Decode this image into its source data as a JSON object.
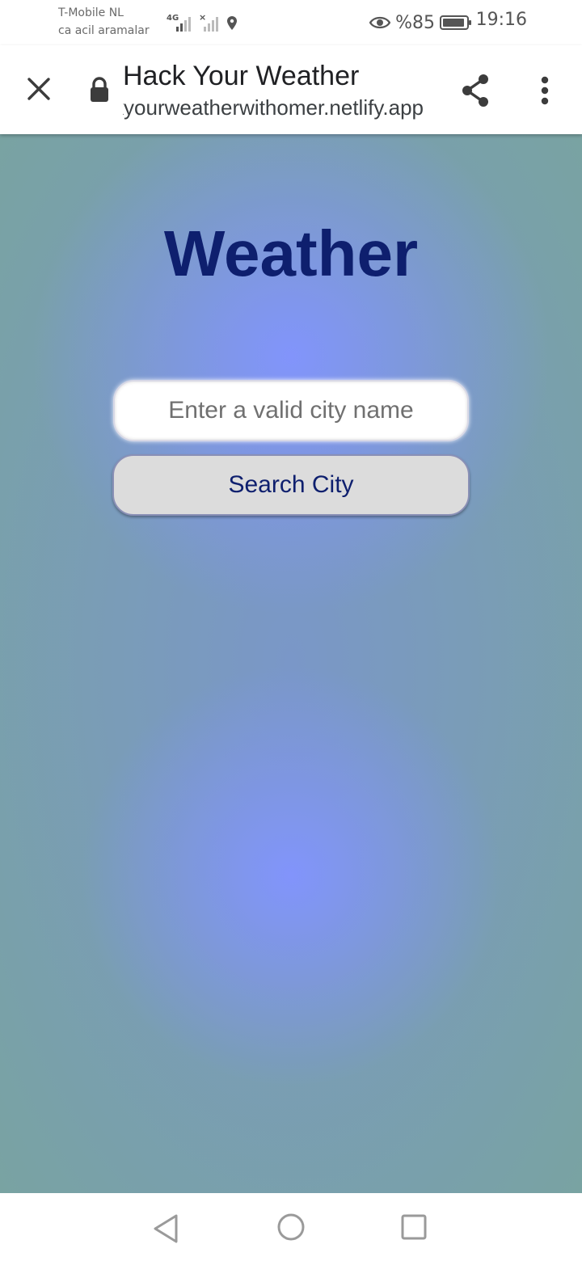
{
  "status_bar": {
    "carrier_line1": "T-Mobile  NL",
    "carrier_line2": "ca acil aramalar",
    "network_type": "4G",
    "battery_percent": "%85",
    "time": "19:16",
    "icons": [
      "signal-icon",
      "no-signal-icon",
      "location-icon",
      "eye-icon",
      "battery-icon"
    ]
  },
  "browser": {
    "page_title": "Hack Your Weather",
    "url": "hackyourweatherwithomer.netlify.app",
    "icons": [
      "close-icon",
      "lock-icon",
      "share-icon",
      "more-vert-icon"
    ]
  },
  "page": {
    "heading": "Weather",
    "city_input": {
      "placeholder": "Enter a valid city name",
      "value": ""
    },
    "search_button_label": "Search City",
    "colors": {
      "heading": "#0e1f6e",
      "background_center": "#8294ff",
      "background_edge": "#79a3a2",
      "button_bg": "#dcdcdc"
    }
  },
  "nav_bar": {
    "icons": [
      "back-icon",
      "home-icon",
      "recents-icon"
    ]
  }
}
